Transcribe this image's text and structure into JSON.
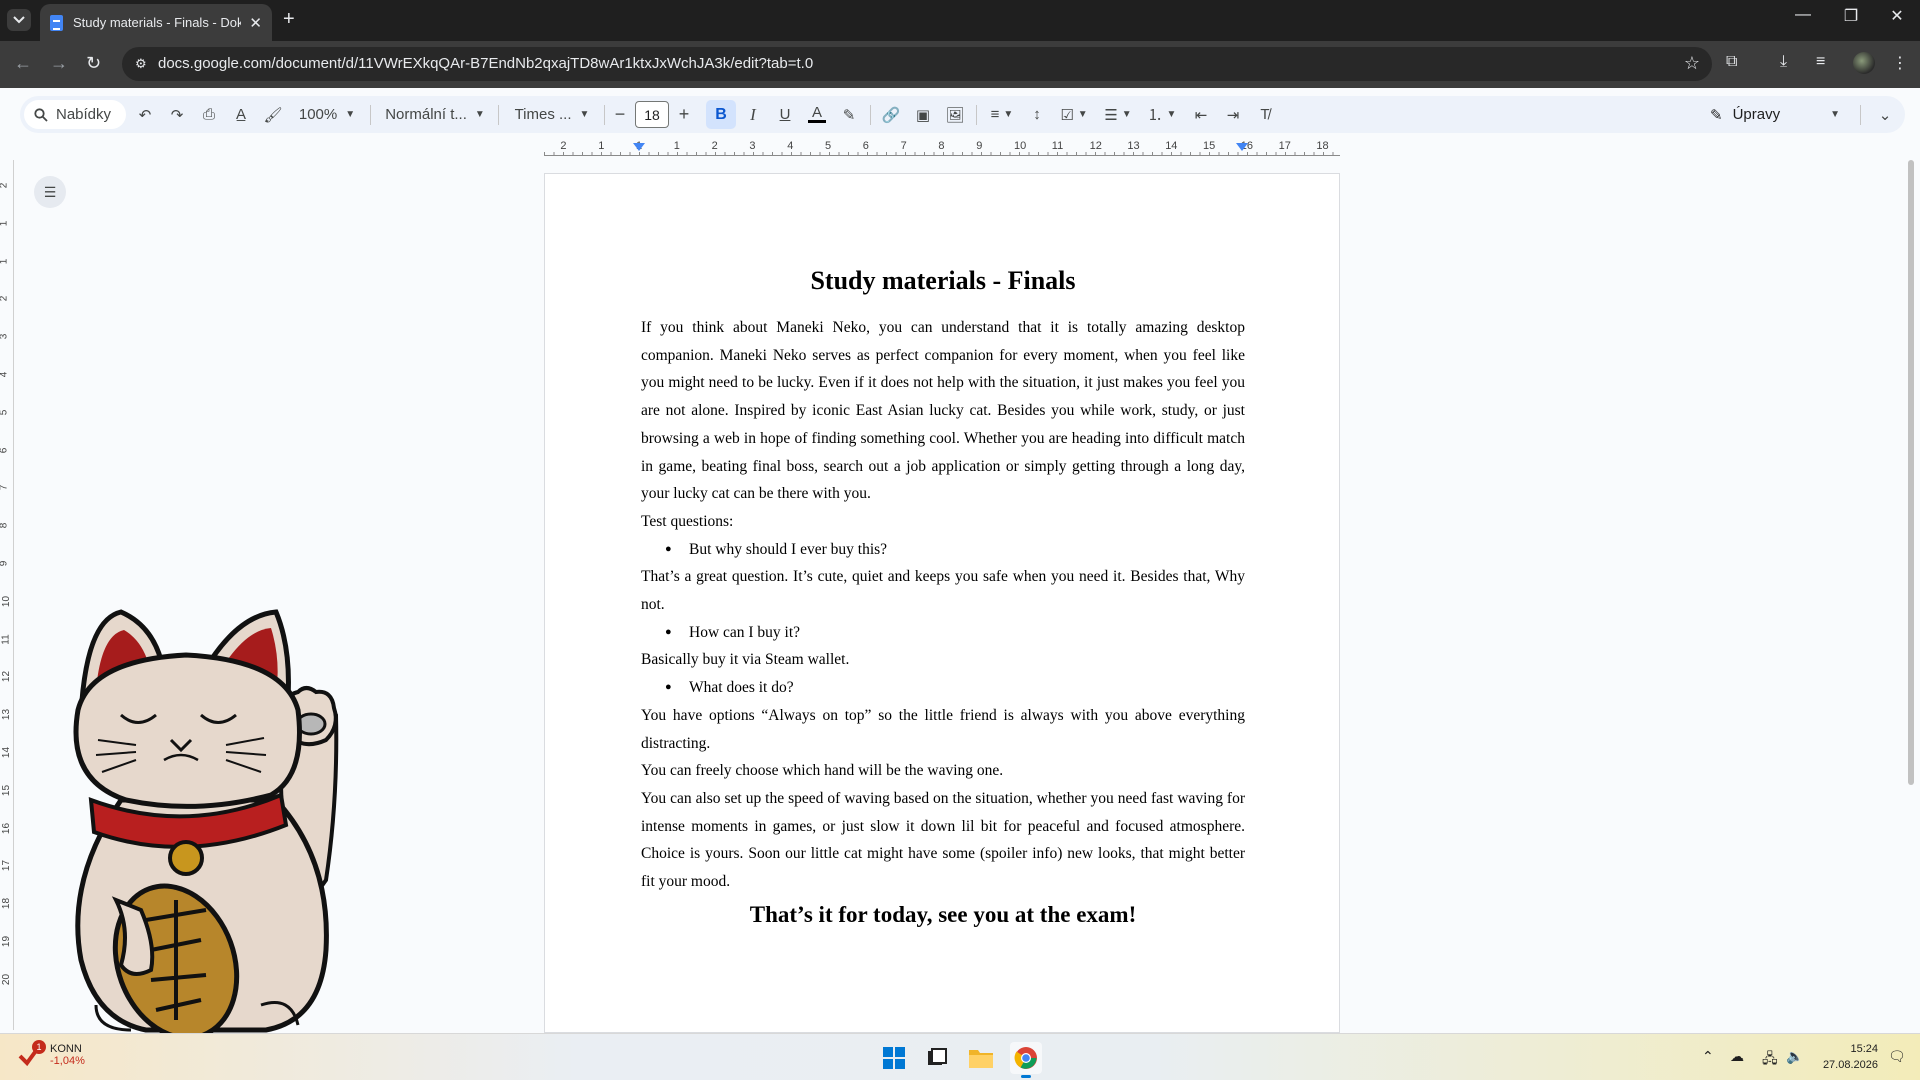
{
  "browser": {
    "tab_title": "Study materials - Finals - Dokum",
    "url": "docs.google.com/document/d/11VWrEXkqQAr-B7EndNb2qxajTD8wAr1ktxJxWchJA3k/edit?tab=t.0"
  },
  "toolbar": {
    "menus_label": "Nabídky",
    "zoom": "100%",
    "style": "Normální t...",
    "font": "Times ...",
    "font_size": "18",
    "mode_label": "Úpravy"
  },
  "ruler": {
    "labels": [
      "2",
      "1",
      "1",
      "1",
      "2",
      "3",
      "4",
      "5",
      "6",
      "7",
      "8",
      "9",
      "10",
      "11",
      "12",
      "13",
      "14",
      "15",
      "16",
      "17",
      "18"
    ],
    "vertical_labels": [
      "2",
      "1",
      "1",
      "2",
      "3",
      "4",
      "5",
      "6",
      "7",
      "8",
      "9",
      "10",
      "11",
      "12",
      "13",
      "14",
      "15",
      "16",
      "17",
      "18",
      "19",
      "20"
    ]
  },
  "document": {
    "title": "Study materials - Finals",
    "intro": "If you think about Maneki Neko, you can understand that it is totally amazing desktop companion. Maneki Neko serves as perfect companion for every moment, when you feel like you might need to be lucky. Even if it does not help with the situation, it just makes you feel you are not alone. Inspired by iconic East Asian lucky cat. Besides you while work, study, or just browsing a web in hope of finding something cool. Whether you are heading into difficult match in game, beating final boss, search out a job application or simply getting through a long day, your lucky cat can be there with you.",
    "test_heading": "Test questions:",
    "q1": "But why should I ever buy this?",
    "a1": "That’s a great question. It’s cute, quiet and keeps you safe when you need it. Besides that, Why not.",
    "q2": "How can I buy it?",
    "a2": "Basically buy it via Steam wallet.",
    "q3": "What does it do?",
    "a3_1": "You have options “Always on top” so the little friend is always with you above everything distracting.",
    "a3_2": "You can freely choose which hand will be the waving one.",
    "a3_3": "You can also set up the speed of waving based on the situation, whether you need fast waving for intense moments in games, or just slow it down lil bit for peaceful and focused atmosphere. Choice is yours. Soon our little cat might have some (spoiler info) new looks, that might better fit your mood.",
    "closing": "That’s it for today, see you at the exam!"
  },
  "taskbar": {
    "stock_name": "KONN",
    "stock_change": "-1,04%",
    "stock_badge": "1",
    "time": "15:24",
    "date": "27.08.2026"
  },
  "colors": {
    "accent": "#0b57d0",
    "toolbar_bg": "#edf2fa",
    "browser_dark": "#1f1f1f"
  }
}
